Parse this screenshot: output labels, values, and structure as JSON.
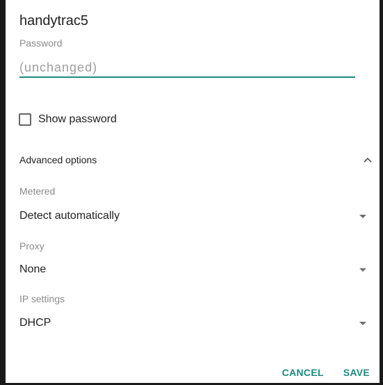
{
  "dialog": {
    "title": "handytrac5",
    "password_label": "Password",
    "password_placeholder": "(unchanged)",
    "show_password_label": "Show password",
    "show_password_checked": false,
    "advanced_label": "Advanced options",
    "advanced_expanded": true,
    "metered": {
      "label": "Metered",
      "value": "Detect automatically"
    },
    "proxy": {
      "label": "Proxy",
      "value": "None"
    },
    "ip_settings": {
      "label": "IP settings",
      "value": "DHCP"
    },
    "cancel_label": "CANCEL",
    "save_label": "SAVE"
  },
  "colors": {
    "accent": "#1d8a7e",
    "text_primary": "#212121",
    "text_secondary": "#8a8a8a"
  },
  "icons": {
    "advanced_toggle": "chevron-up-icon",
    "spinner_arrow": "triangle-down-icon"
  }
}
